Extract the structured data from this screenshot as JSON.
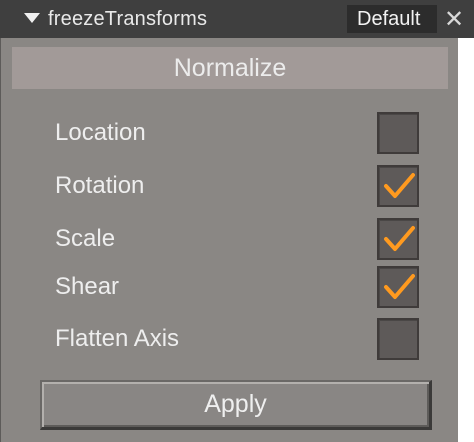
{
  "titlebar": {
    "title": "freezeTransforms",
    "preset": "Default",
    "close_glyph": "✕",
    "collapse_icon": "triangle-down-icon"
  },
  "section": {
    "title": "Normalize"
  },
  "options": [
    {
      "label": "Location",
      "checked": false
    },
    {
      "label": "Rotation",
      "checked": true
    },
    {
      "label": "Scale",
      "checked": true
    },
    {
      "label": "Shear",
      "checked": true
    },
    {
      "label": "Flatten Axis",
      "checked": false
    }
  ],
  "apply_label": "Apply",
  "colors": {
    "titlebar_bg": "#3f3f3f",
    "panel_bg": "#8a8784",
    "section_header_bg": "#a29a98",
    "checkmark": "#ff9a1f",
    "checkbox_bg": "#5e5a59"
  }
}
